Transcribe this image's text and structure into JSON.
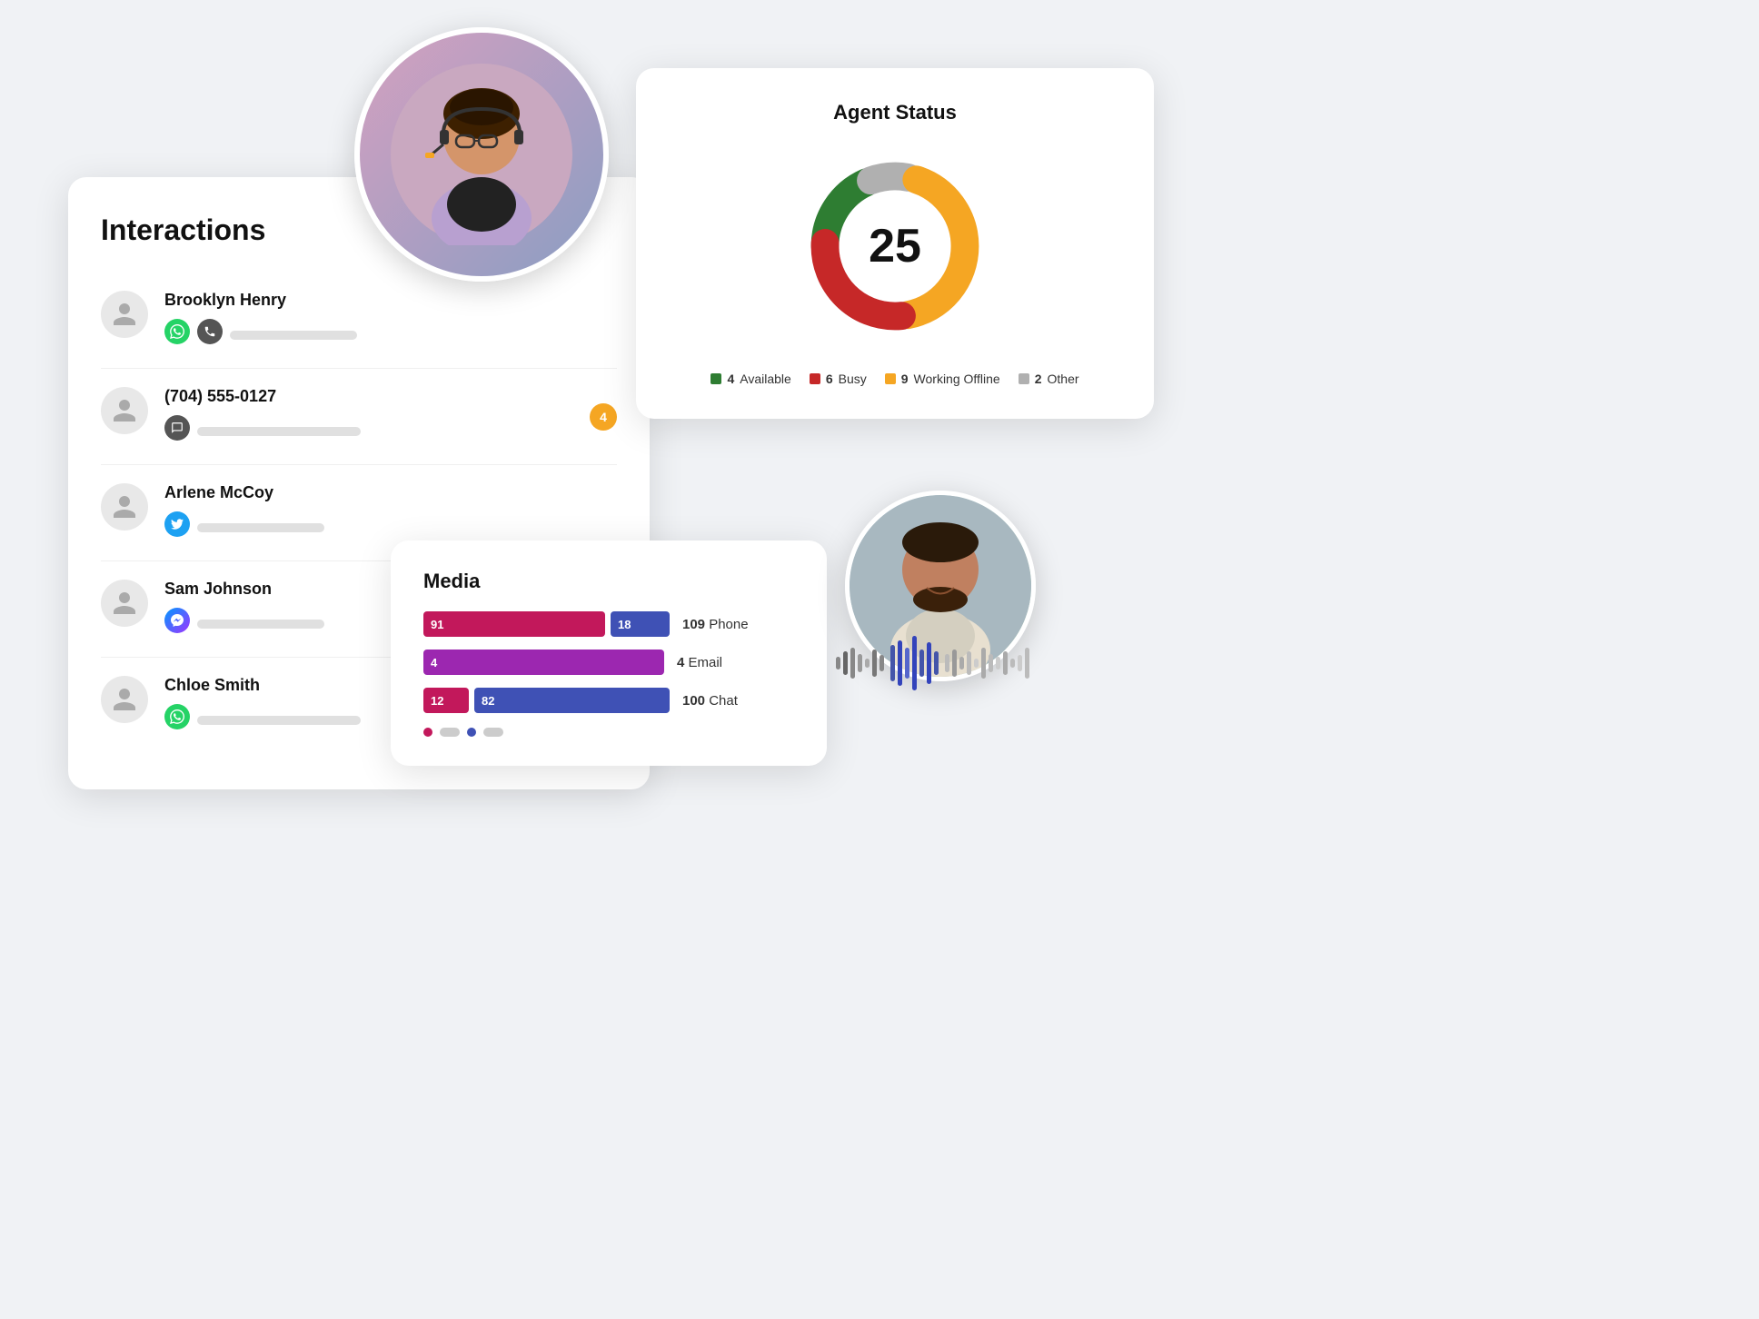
{
  "interactions": {
    "title": "Interactions",
    "items": [
      {
        "name": "Brooklyn Henry",
        "channels": [
          "whatsapp",
          "phone"
        ],
        "placeholder_widths": [
          140
        ]
      },
      {
        "name": "(704) 555-0127",
        "channels": [
          "chat"
        ],
        "badge": "4",
        "placeholder_widths": [
          150
        ]
      },
      {
        "name": "Arlene McCoy",
        "channels": [
          "twitter"
        ],
        "placeholder_widths": [
          120
        ]
      },
      {
        "name": "Sam Johnson",
        "channels": [
          "messenger"
        ],
        "placeholder_widths": [
          130
        ]
      },
      {
        "name": "Chloe Smith",
        "channels": [
          "whatsapp"
        ],
        "placeholder_widths": [
          140
        ]
      }
    ]
  },
  "agent_status": {
    "title": "Agent Status",
    "total": "25",
    "legend": [
      {
        "label": "Available",
        "count": "4",
        "color": "#2E7D32"
      },
      {
        "label": "Busy",
        "count": "6",
        "color": "#C62828"
      },
      {
        "label": "Working Offline",
        "count": "9",
        "color": "#F5A623"
      },
      {
        "label": "Other",
        "count": "2",
        "color": "#B0B0B0"
      }
    ],
    "donut_segments": [
      {
        "label": "Available",
        "value": 4,
        "color": "#2E7D32"
      },
      {
        "label": "Busy",
        "value": 6,
        "color": "#C62828"
      },
      {
        "label": "Working Offline",
        "value": 9,
        "color": "#F5A623"
      },
      {
        "label": "Other",
        "value": 2,
        "color": "#B0B0B0"
      }
    ]
  },
  "media": {
    "title": "Media",
    "rows": [
      {
        "segments": [
          {
            "value": 91,
            "type": "pink"
          },
          {
            "value": 18,
            "type": "blue"
          }
        ],
        "total": "109",
        "label": "Phone"
      },
      {
        "segments": [
          {
            "value": 4,
            "type": "purple"
          }
        ],
        "total": "4",
        "label": "Email"
      },
      {
        "segments": [
          {
            "value": 12,
            "type": "pink"
          },
          {
            "value": 82,
            "type": "blue"
          }
        ],
        "total": "100",
        "label": "Chat"
      }
    ]
  }
}
